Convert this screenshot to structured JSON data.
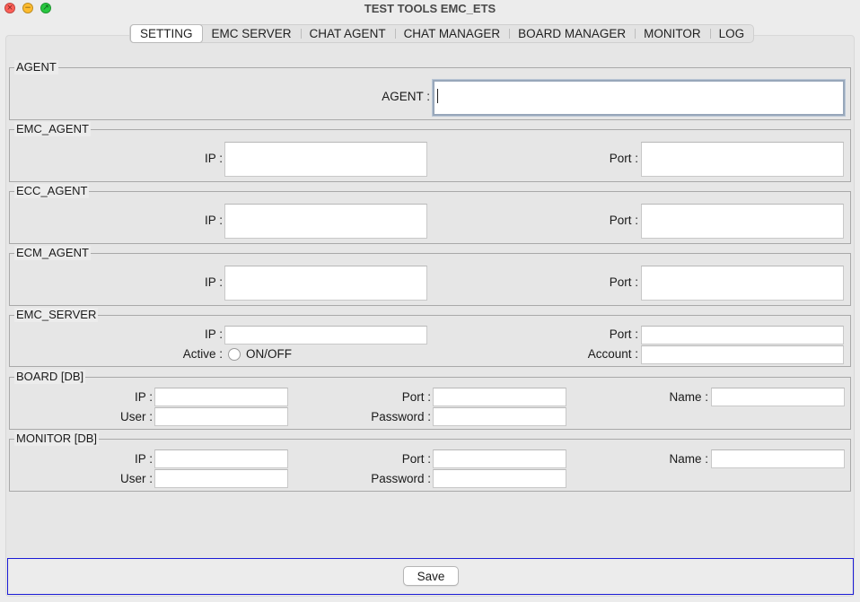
{
  "window": {
    "title": "TEST TOOLS EMC_ETS"
  },
  "tabs": [
    "SETTING",
    "EMC SERVER",
    "CHAT AGENT",
    "CHAT MANAGER",
    "BOARD MANAGER",
    "MONITOR",
    "LOG"
  ],
  "active_tab": "SETTING",
  "groups": {
    "agent": {
      "title": "AGENT",
      "agent_label": "AGENT :",
      "agent_value": ""
    },
    "emc_agent": {
      "title": "EMC_AGENT",
      "ip_label": "IP :",
      "port_label": "Port :",
      "ip_value": "",
      "port_value": ""
    },
    "ecc_agent": {
      "title": "ECC_AGENT",
      "ip_label": "IP :",
      "port_label": "Port :",
      "ip_value": "",
      "port_value": ""
    },
    "ecm_agent": {
      "title": "ECM_AGENT",
      "ip_label": "IP :",
      "port_label": "Port :",
      "ip_value": "",
      "port_value": ""
    },
    "emc_server": {
      "title": "EMC_SERVER",
      "ip_label": "IP :",
      "port_label": "Port :",
      "active_label": "Active :",
      "onoff_label": "ON/OFF",
      "account_label": "Account :",
      "ip_value": "",
      "port_value": "",
      "account_value": "",
      "active_checked": false
    },
    "board_db": {
      "title": "BOARD [DB]",
      "ip_label": "IP :",
      "port_label": "Port :",
      "name_label": "Name :",
      "user_label": "User :",
      "password_label": "Password :",
      "ip_value": "",
      "port_value": "",
      "name_value": "",
      "user_value": "",
      "password_value": ""
    },
    "monitor_db": {
      "title": "MONITOR [DB]",
      "ip_label": "IP :",
      "port_label": "Port :",
      "name_label": "Name :",
      "user_label": "User :",
      "password_label": "Password :",
      "ip_value": "",
      "port_value": "",
      "name_value": "",
      "user_value": "",
      "password_value": ""
    }
  },
  "save_label": "Save",
  "icons": {
    "close": "close-icon",
    "minimize": "minimize-icon",
    "maximize": "maximize-icon"
  },
  "colors": {
    "close": "#ff5f57",
    "minimize": "#febc2e",
    "maximize": "#28c840",
    "save_panel_border": "#1b1bd6",
    "focus_border": "#98a7ba"
  }
}
